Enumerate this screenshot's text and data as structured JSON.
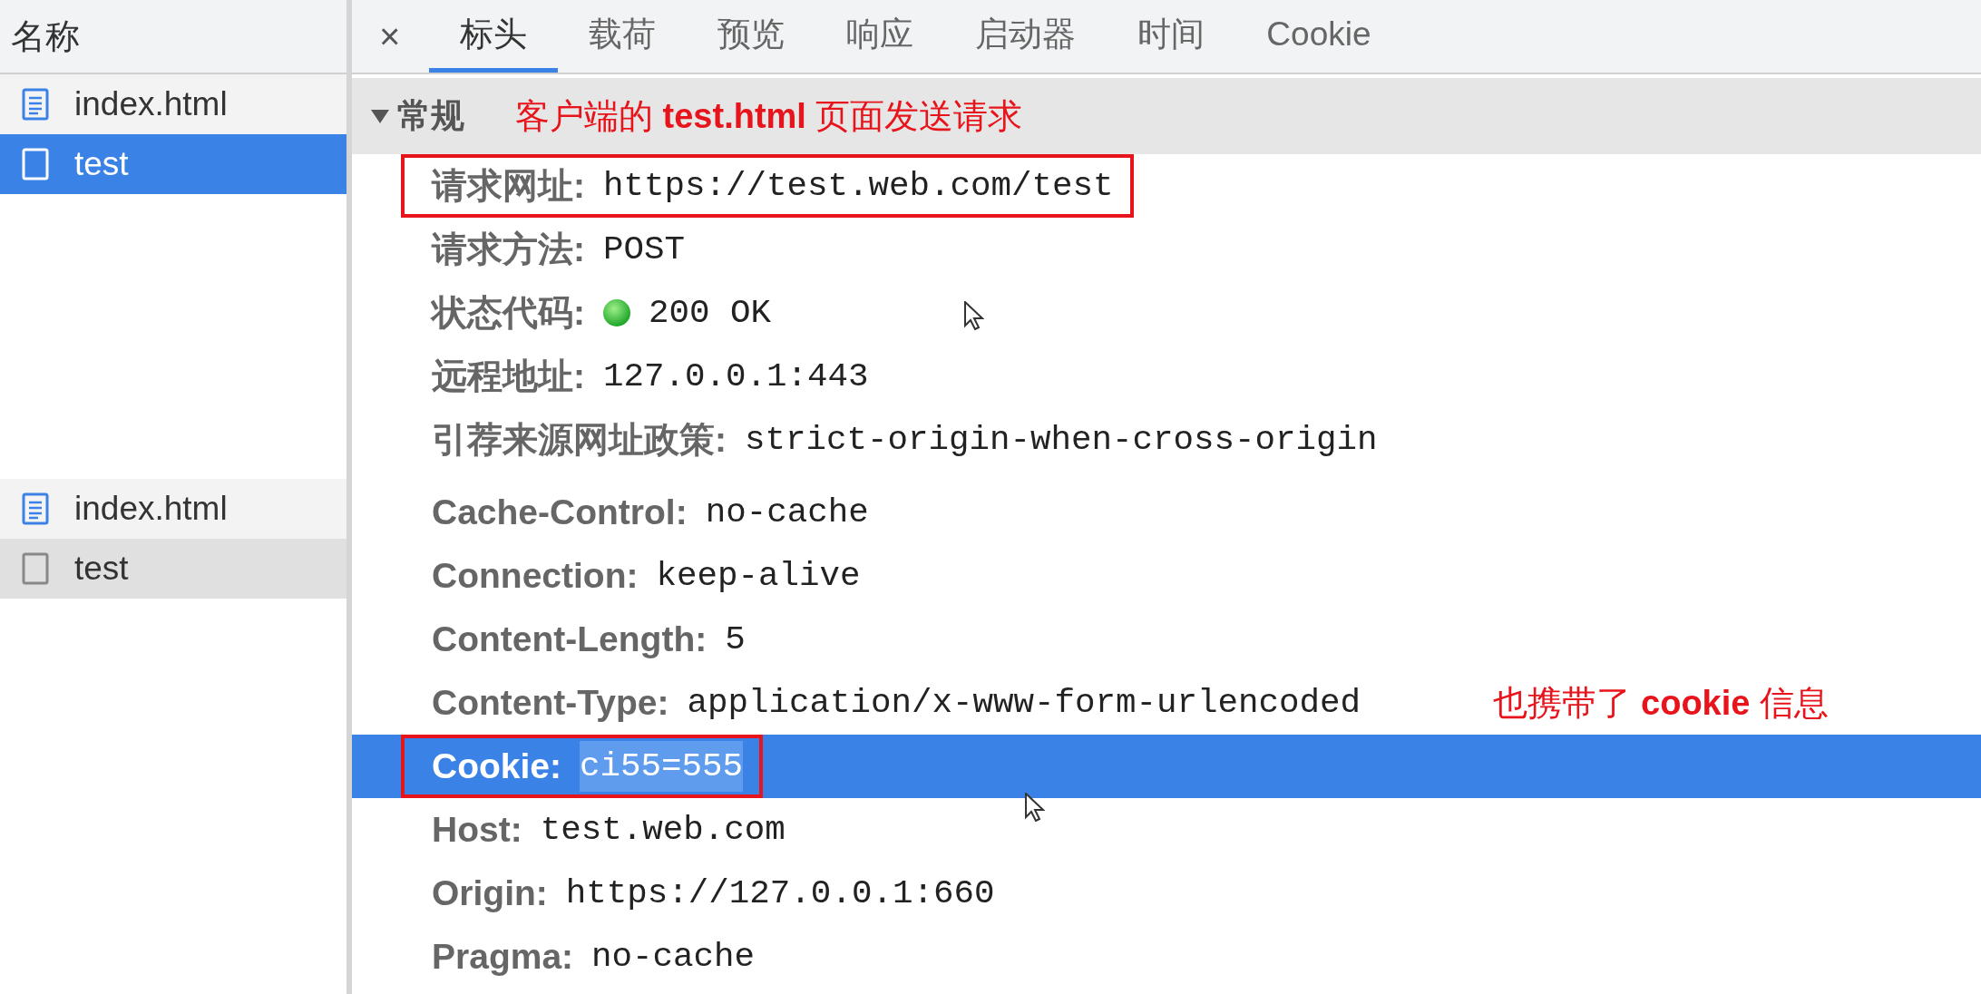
{
  "sidebar": {
    "header": "名称",
    "groups": [
      {
        "focused": true,
        "items": [
          {
            "name": "index.html",
            "kind": "document",
            "selected": false
          },
          {
            "name": "test",
            "kind": "blank",
            "selected": true
          }
        ]
      },
      {
        "focused": false,
        "items": [
          {
            "name": "index.html",
            "kind": "document",
            "selected": false
          },
          {
            "name": "test",
            "kind": "blank",
            "selected": true
          }
        ]
      }
    ]
  },
  "tabs": {
    "close": "×",
    "items": [
      {
        "label": "标头",
        "selected": true
      },
      {
        "label": "载荷",
        "selected": false
      },
      {
        "label": "预览",
        "selected": false
      },
      {
        "label": "响应",
        "selected": false
      },
      {
        "label": "启动器",
        "selected": false
      },
      {
        "label": "时间",
        "selected": false
      },
      {
        "label": "Cookie",
        "selected": false
      }
    ]
  },
  "general": {
    "title": "常规",
    "expanded": true,
    "note": "客户端的 **test.html** 页面发送请求",
    "rows": [
      {
        "label": "请求网址:",
        "value": "https://test.web.com/test",
        "highlighted": true,
        "selected": false
      },
      {
        "label": "请求方法:",
        "value": "POST",
        "highlighted": false,
        "selected": false
      },
      {
        "label": "状态代码:",
        "value": "200 OK",
        "kind": "status",
        "highlighted": false,
        "selected": false
      },
      {
        "label": "远程地址:",
        "value": "127.0.0.1:443",
        "highlighted": false,
        "selected": false
      },
      {
        "label": "引荐来源网址政策:",
        "value": "strict-origin-when-cross-origin",
        "highlighted": false,
        "selected": false
      }
    ]
  },
  "request_headers": {
    "rows": [
      {
        "label": "Cache-Control:",
        "value": "no-cache",
        "highlighted": false,
        "selected": false
      },
      {
        "label": "Connection:",
        "value": "keep-alive",
        "highlighted": false,
        "selected": false
      },
      {
        "label": "Content-Length:",
        "value": "5",
        "highlighted": false,
        "selected": false
      },
      {
        "label": "Content-Type:",
        "value": "application/x-www-form-urlencoded",
        "note": "也携带了 **cookie** 信息",
        "highlighted": false,
        "selected": false
      },
      {
        "label": "Cookie:",
        "value": "ci55=555",
        "highlighted": true,
        "selected": true
      },
      {
        "label": "Host:",
        "value": "test.web.com",
        "highlighted": false,
        "selected": false
      },
      {
        "label": "Origin:",
        "value": "https://127.0.0.1:660",
        "highlighted": false,
        "selected": false
      },
      {
        "label": "Pragma:",
        "value": "no-cache",
        "highlighted": false,
        "selected": false
      }
    ]
  }
}
